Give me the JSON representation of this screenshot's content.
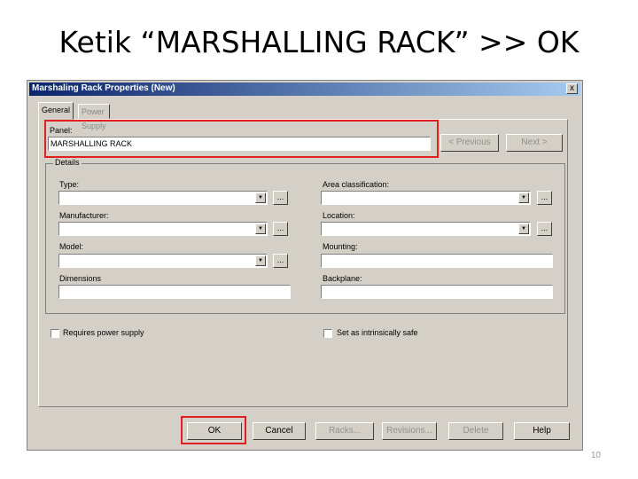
{
  "slide": {
    "title": "Ketik “MARSHALLING RACK” >> OK",
    "page_number": "10"
  },
  "dialog": {
    "title": "Marshaling Rack Properties (New)",
    "close_label": "x",
    "tabs": [
      {
        "label": "General",
        "active": true
      },
      {
        "label": "Power Supply",
        "active": false
      }
    ],
    "panel": {
      "label": "Panel:",
      "value": "MARSHALLING RACK"
    },
    "previous_label": "< Previous",
    "next_label": "Next >",
    "details": {
      "group_label": "Details",
      "type_label": "Type:",
      "manufacturer_label": "Manufacturer:",
      "model_label": "Model:",
      "dimensions_label": "Dimensions",
      "area_label": "Area classification:",
      "location_label": "Location:",
      "mounting_label": "Mounting:",
      "backplane_label": "Backplane:",
      "ellipsis": "..."
    },
    "requires_power_supply": {
      "label": "Requires power supply",
      "checked": false
    },
    "intrinsically_safe": {
      "label": "Set as intrinsically safe",
      "checked": false
    },
    "buttons": {
      "ok": "OK",
      "cancel": "Cancel",
      "racks": "Racks...",
      "revisions": "Revisions...",
      "delete": "Delete",
      "help": "Help"
    },
    "highlight_color": "#e02020"
  }
}
